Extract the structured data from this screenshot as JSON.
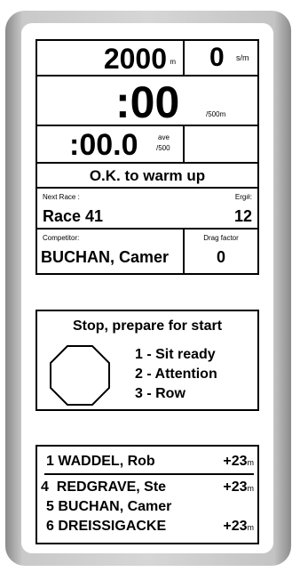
{
  "monitor": {
    "distance": "2000",
    "distance_unit": "m",
    "stroke_rate": "0",
    "stroke_rate_unit": "s/m",
    "split_time": ":00",
    "split_unit": "/500m",
    "avg_time": ":00.0",
    "avg_label": "ave",
    "avg_unit": "/500",
    "status": "O.K. to warm up",
    "next_race_label": "Next Race :",
    "next_race_value": "Race 41",
    "erg_label": "Erg#:",
    "erg_value": "12",
    "competitor_label": "Competitor:",
    "competitor_value": "BUCHAN, Camer",
    "drag_label": "Drag factor",
    "drag_value": "0"
  },
  "start_box": {
    "title": "Stop, prepare for start",
    "steps": [
      "1 - Sit ready",
      "2 - Attention",
      "3 - Row"
    ]
  },
  "standings": {
    "rows": [
      {
        "rank": "1",
        "name": "WADDEL, Rob",
        "gap": "+23",
        "unit": "m"
      },
      {
        "rank": "4",
        "name": "REDGRAVE, Ste",
        "gap": "+23",
        "unit": "m"
      },
      {
        "rank": "5",
        "name": "BUCHAN, Camer",
        "gap": "",
        "unit": ""
      },
      {
        "rank": "6",
        "name": "DREISSIGACKE",
        "gap": "+23",
        "unit": "m"
      }
    ]
  }
}
